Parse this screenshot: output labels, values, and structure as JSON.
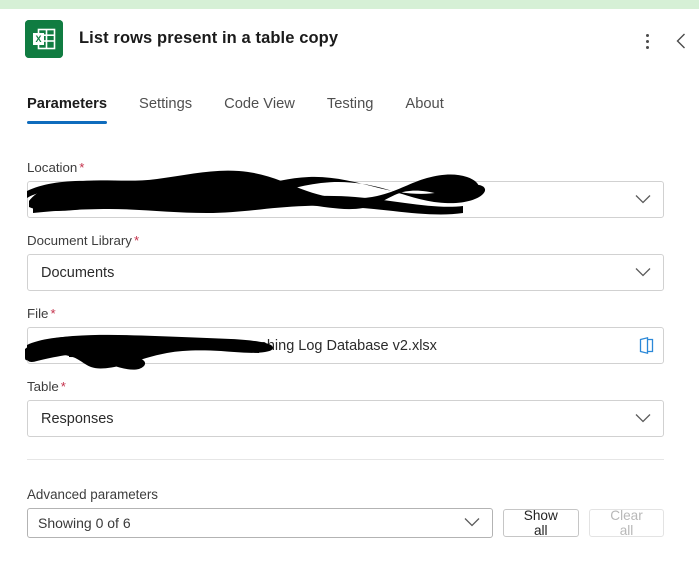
{
  "window": {
    "accent_band_color": "#d6f0d6",
    "brand_color": "#107c41",
    "tab_accent_color": "#0f6cbd",
    "required_marker_color": "#c4314b"
  },
  "header": {
    "icon_name": "excel-app-icon",
    "title": "List rows present in a table copy",
    "more_options_label": "More commands",
    "collapse_label": "Collapse"
  },
  "tabs": [
    {
      "label": "Parameters",
      "active": true
    },
    {
      "label": "Settings",
      "active": false
    },
    {
      "label": "Code View",
      "active": false
    },
    {
      "label": "Testing",
      "active": false
    },
    {
      "label": "About",
      "active": false
    }
  ],
  "fields": [
    {
      "label": "Location",
      "required_marker": "*",
      "value": "",
      "redacted": true,
      "control": "dropdown"
    },
    {
      "label": "Document Library",
      "required_marker": "*",
      "value": "Documents",
      "redacted": false,
      "control": "dropdown"
    },
    {
      "label": "File",
      "required_marker": "*",
      "value": "Coaching Log Database v2.xlsx",
      "redacted": true,
      "control": "file-picker"
    },
    {
      "label": "Table",
      "required_marker": "*",
      "value": "Responses",
      "redacted": false,
      "control": "dropdown"
    }
  ],
  "advanced": {
    "label": "Advanced parameters",
    "select_value": "Showing 0 of 6",
    "show_all_label": "Show all",
    "clear_all_label": "Clear all",
    "clear_all_disabled": true
  }
}
